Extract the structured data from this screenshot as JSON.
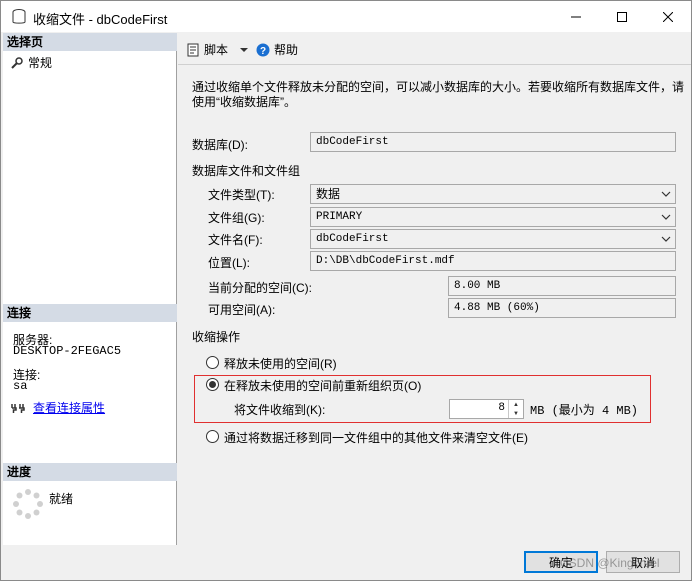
{
  "window": {
    "title": "收缩文件 - dbCodeFirst"
  },
  "sidebar": {
    "select_page_header": "选择页",
    "pages": [
      {
        "label": "常规"
      }
    ],
    "connection_header": "连接",
    "server_label": "服务器:",
    "server_value": "DESKTOP-2FEGAC5",
    "connection_label": "连接:",
    "connection_value": "sa",
    "view_props_link": "查看连接属性",
    "progress_header": "进度",
    "progress_status": "就绪"
  },
  "toolbar": {
    "script_label": "脚本",
    "help_label": "帮助"
  },
  "main": {
    "description": "通过收缩单个文件释放未分配的空间，可以减小数据库的大小。若要收缩所有数据库文件，请使用“收缩数据库”。",
    "database_label": "数据库(D):",
    "database_value": "dbCodeFirst",
    "files_section": "数据库文件和文件组",
    "file_type_label": "文件类型(T):",
    "file_type_value": "数据",
    "filegroup_label": "文件组(G):",
    "filegroup_value": "PRIMARY",
    "filename_label": "文件名(F):",
    "filename_value": "dbCodeFirst",
    "location_label": "位置(L):",
    "location_value": "D:\\DB\\dbCodeFirst.mdf",
    "allocated_label": "当前分配的空间(C):",
    "allocated_value": "8.00 MB",
    "available_label": "可用空间(A):",
    "available_value": "4.88 MB (60%)",
    "shrink_section": "收缩操作",
    "option_release": "释放未使用的空间(R)",
    "option_reorganize": "在释放未使用的空间前重新组织页(O)",
    "shrink_to_label": "将文件收缩到(K):",
    "shrink_to_value": "8",
    "shrink_to_unit": "MB (最小为 4 MB)",
    "option_empty": "通过将数据迁移到同一文件组中的其他文件来清空文件(E)",
    "selected_option": "reorganize"
  },
  "buttons": {
    "ok": "确定",
    "cancel": "取消"
  },
  "watermark": "CSDN @Kingcruel"
}
